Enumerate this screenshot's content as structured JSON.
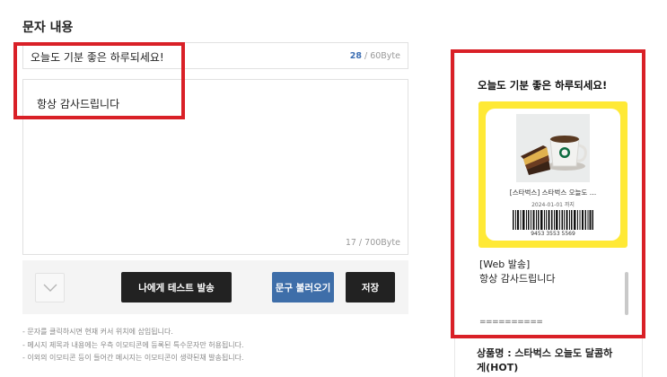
{
  "section": {
    "title": "문자 내용"
  },
  "subject": {
    "value": "오늘도 기분 좋은 하루되세요!",
    "count": "28",
    "limit": " / 60Byte"
  },
  "body": {
    "value": "항상 감사드립니다",
    "count": "17",
    "limit": " / 700Byte"
  },
  "buttons": {
    "test_send": "나에게 테스트 발송",
    "load_phrase": "문구 불러오기",
    "save": "저장"
  },
  "notes": [
    "- 문자를 클릭하시면 현재 커서 위치에 삽입됩니다.",
    "- 메시지 제목과 내용에는 우측 이모티콘에 등록된 특수문자만 허용됩니다.",
    "- 이외의 이모티콘 등이 들어간 메시지는 이모티콘이 생략된채 발송됩니다."
  ],
  "preview": {
    "subject": "오늘도 기분 좋은 하루되세요!",
    "coupon": {
      "product_name": "[스타벅스] 스타벅스 오늘도 …",
      "expiry": "2024-01-01 까지",
      "barcode_number": "9453 3553 5569"
    },
    "web_tag": "[Web 발송]",
    "body": "항상 감사드립니다",
    "separator": "==========",
    "product_line_1": "상품명 : 스타벅스 오늘도 달콤하",
    "product_line_2": "게(HOT)"
  },
  "colors": {
    "highlight": "#d92027",
    "coupon_bg": "#ffe936",
    "accent_blue": "#3e6ea9"
  }
}
